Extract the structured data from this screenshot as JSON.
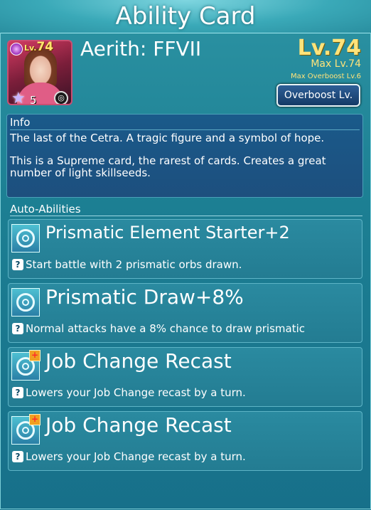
{
  "title": "Ability Card",
  "card": {
    "name": "Aerith: FFVII",
    "level": "Lv.74",
    "max_level": "Max Lv.74",
    "max_overboost": "Max Overboost Lv.6",
    "portrait_level_prefix": "Lv.",
    "portrait_level": "74",
    "star_count": "5",
    "overboost_button": "Overboost Lv."
  },
  "info": {
    "heading": "Info",
    "lines": [
      "The last of the Cetra. A tragic figure and a symbol of hope.",
      "This is a Supreme card, the rarest of cards. Creates a great number of light skillseeds."
    ]
  },
  "auto_abilities": {
    "heading": "Auto-Abilities",
    "items": [
      {
        "name": "Prismatic Element Starter+2",
        "desc": "Start battle with 2 prismatic orbs drawn.",
        "icon": "prismatic-ability-icon"
      },
      {
        "name": "Prismatic Draw+8%",
        "desc": " Normal attacks have a 8% chance to draw prismatic",
        "icon": "prismatic-ability-icon"
      },
      {
        "name": "Job Change Recast",
        "desc": "Lowers your Job Change recast by a turn.",
        "icon": "job-change-ability-icon"
      },
      {
        "name": "Job Change Recast",
        "desc": "Lowers your Job Change recast by a turn.",
        "icon": "job-change-ability-icon"
      }
    ]
  },
  "icons": {
    "help": "?",
    "star": "★",
    "plus": "+"
  }
}
